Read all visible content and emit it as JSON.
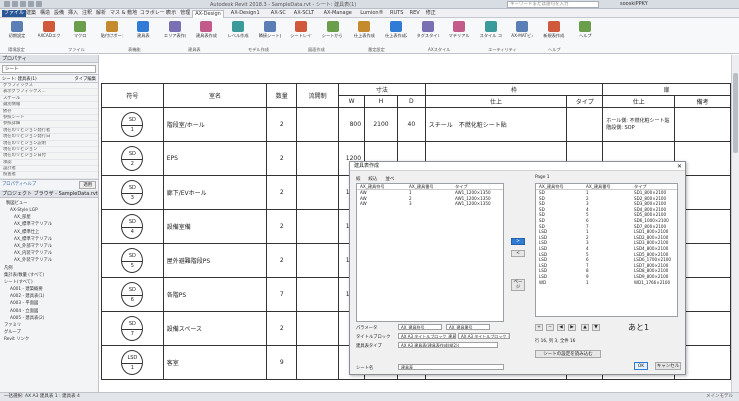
{
  "window": {
    "app_title": "Autodesk Revit 2018.3 - SampleData.rvt - シート: 建具表(1)",
    "search_placeholder": "キーワードまたは語句を入力",
    "user": "sooskiPPKY"
  },
  "menu": {
    "file": "ファイル",
    "tabs": [
      "建築",
      "構造",
      "設備",
      "挿入",
      "注釈",
      "解析",
      "マス & 敷地",
      "コラボレート",
      "表示",
      "管理",
      "AX-Design",
      "AX-Design1",
      "AX-SC",
      "AX-SCLT",
      "AX-Manage",
      "Lumion®",
      "RUTS",
      "REV",
      "修正"
    ],
    "active_index": 10
  },
  "ribbon": {
    "buttons": [
      "初期設定",
      "AXCADエクスポート",
      "マクロ",
      "貼付けボード",
      "建具表",
      "エリア表作成",
      "建具表作成",
      "レベル作成",
      "隣接シート自動作成",
      "シートレイアウト",
      "シートから EXCEL",
      "仕上表作成",
      "仕上表作成2",
      "タグスタイル",
      "マテリアル",
      "スタイル コピー",
      "AX-MATビューアー",
      "新規表作成",
      "ヘルプ"
    ],
    "groups": [
      "環境設定",
      "ファイル",
      "表機能",
      "建具表",
      "モデル作成",
      "図面作成",
      "番定設定",
      "AXスタイル",
      "ユーティリティ",
      "ヘルプ"
    ]
  },
  "properties_panel": {
    "title": "プロパティ",
    "type_label": "シート",
    "selector": "シート: 建具表(1)",
    "edit_type": "タイプ編集",
    "rows": [
      "グラフィックス",
      "表示グラフィックス...",
      "スケール",
      "識別情報",
      "依存",
      "参照シート",
      "参照詳細",
      "現在のリビジョン発行者",
      "現在のリビジョン発行日",
      "現在のリビジョン説明",
      "現在のリビジョン",
      "現在のリビジョン日付",
      "承認",
      "設計者",
      "照査者"
    ],
    "help": "プロパティヘルプ",
    "apply": "適用"
  },
  "browser_panel": {
    "title": "プロジェクト ブラウザ - SampleData.rvt",
    "rows": [
      "製図ビュー",
      "AX-Style LGP",
      "AX_部屋",
      "AX_標準マテリアル",
      "AX_標準仕上",
      "AX_標準マテリアル",
      "AX_外部マテリアル",
      "AX_内装マテリアル",
      "AX_外装マテリアル",
      "凡例",
      "集計表/数量 (すべて)",
      "シート(すべて)",
      "A001 - 建築概要",
      "A002 - 建具表(1)",
      "A003 - 平面図",
      "A004 - 立面図",
      "A005 - 建具表(2)",
      "ファミリ",
      "グループ",
      "Revit リンク"
    ]
  },
  "schedule": {
    "headers": {
      "symbol": "符号",
      "room": "室名",
      "qty": "数量",
      "spec": "流開制",
      "dims": "寸法",
      "w": "W",
      "h": "H",
      "d": "D",
      "frame": "枠",
      "frame_finish": "仕上",
      "type": "タイプ",
      "door": "扉",
      "door_finish": "仕上",
      "note": "備考"
    },
    "rows": [
      {
        "sym_top": "SD",
        "sym_bot": "1",
        "room": "階段室/ホール",
        "qty": "2",
        "w": "800",
        "h": "2100",
        "d": "40",
        "frame": "スチール　不燃化粧シート貼",
        "door": "ホール側: 不燃化粧シート貼",
        "door2": "階段側: SOP"
      },
      {
        "sym_top": "SD",
        "sym_bot": "2",
        "room": "EPS",
        "qty": "2",
        "w": "1200",
        "h": "",
        "d": "",
        "frame": "",
        "door": "",
        "door2": ""
      },
      {
        "sym_top": "SD",
        "sym_bot": "3",
        "room": "廊下/EVホール",
        "qty": "2",
        "w": "1200",
        "h": "",
        "d": "",
        "frame": "",
        "door": "",
        "door2": ""
      },
      {
        "sym_top": "SD",
        "sym_bot": "4",
        "room": "設備室備",
        "qty": "2",
        "w": "1200",
        "h": "",
        "d": "",
        "frame": "",
        "door": "",
        "door2": ""
      },
      {
        "sym_top": "SD",
        "sym_bot": "5",
        "room": "屋外避難階段PS",
        "qty": "2",
        "w": "1200",
        "h": "",
        "d": "",
        "frame": "",
        "door": "",
        "door2": ""
      },
      {
        "sym_top": "SD",
        "sym_bot": "6",
        "room": "各階PS",
        "qty": "7",
        "w": "1000",
        "h": "",
        "d": "",
        "frame": "",
        "door": "",
        "door2": ""
      },
      {
        "sym_top": "SD",
        "sym_bot": "7",
        "room": "設備スペース",
        "qty": "2",
        "w": "800",
        "h": "",
        "d": "",
        "frame": "",
        "door": "",
        "door2": ""
      },
      {
        "sym_top": "LSD",
        "sym_bot": "1",
        "room": "客室",
        "qty": "9",
        "w": "800",
        "h": "",
        "d": "",
        "frame": "",
        "door": "",
        "door2": ""
      }
    ]
  },
  "dialog": {
    "title": "建具表作成",
    "tabs": [
      "絞",
      "絞込",
      "並べ"
    ],
    "left_headers": [
      "AX_建具符号",
      "AX_建具番号",
      "タイプ"
    ],
    "left_rows": [
      [
        "AW",
        "1",
        "AW1_1200×1350"
      ],
      [
        "AW",
        "2",
        "AW1_1200×1350"
      ],
      [
        "AW",
        "3",
        "AW1_1200×1350"
      ]
    ],
    "right_page_label": "Page 1",
    "right_headers": [
      "AX_建具符号",
      "AX_建具番号",
      "タイプ"
    ],
    "right_rows": [
      [
        "SD",
        "1",
        "SD1_800×2100"
      ],
      [
        "SD",
        "2",
        "SD2_800×2100"
      ],
      [
        "SD",
        "3",
        "SD3_800×2100"
      ],
      [
        "SD",
        "4",
        "SD4_800×2100"
      ],
      [
        "SD",
        "5",
        "SD5_800×2100"
      ],
      [
        "SD",
        "6",
        "SD6_1000×2100"
      ],
      [
        "SD",
        "7",
        "SD7_800×2100"
      ],
      [
        "LSD",
        "1",
        "LSD1_800×2100"
      ],
      [
        "LSD",
        "2",
        "LSD2_800×2100"
      ],
      [
        "LSD",
        "3",
        "LSD3_800×2100"
      ],
      [
        "LSD",
        "4",
        "LSD4_800×2100"
      ],
      [
        "LSD",
        "5",
        "LSD5_800×2100"
      ],
      [
        "LSD",
        "6",
        "LSD6_1700×2100"
      ],
      [
        "LSD",
        "7",
        "LSD7_800×2100"
      ],
      [
        "LSD",
        "8",
        "LSD8_800×2100"
      ],
      [
        "LSD",
        "9",
        "LSD9_800×2100"
      ],
      [
        "WD",
        "1",
        "WD1_1766×2100"
      ]
    ],
    "move_right": ">",
    "move_left": "<",
    "page_prev": "ページ",
    "page_next": "ページ",
    "ato": "あと1",
    "status": "行 16, 列 3, 全件 16",
    "field_labels": [
      "パラメータ",
      "タイトルブロック",
      "建具表タイプ",
      "シート名"
    ],
    "param1": "AX_建具符号",
    "param2": "AX_建具番号",
    "titleblock": "AX A3 タイトルブロック_建具表",
    "titleblock2": "AX A3 タイトルブロック_建具",
    "sched_type": "AX A3 建具表(建具表作成(縦2))",
    "sheet_name": "建具表",
    "load_button": "シートの設定を読み込む",
    "ok": "OK",
    "cancel": "キャンセル"
  },
  "status": {
    "left": "一括選択: AX A3 建具表 1 : 建具表 4",
    "right": "メインモデル"
  }
}
